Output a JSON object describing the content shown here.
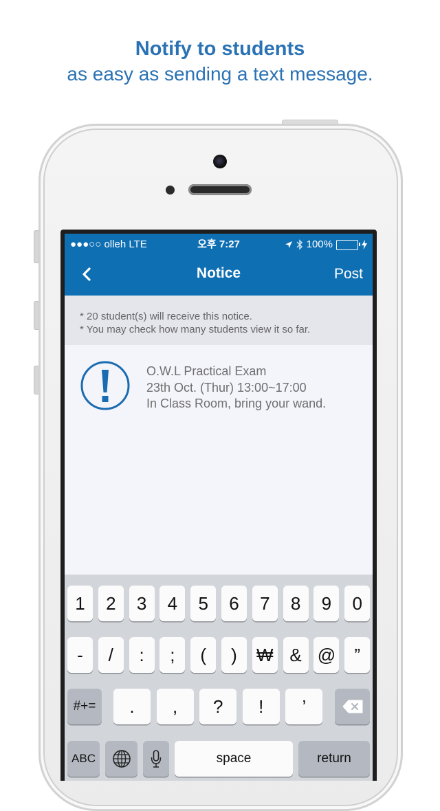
{
  "headline": {
    "title": "Notify to students",
    "subtitle": "as easy as sending a text message."
  },
  "status_bar": {
    "carrier": "●●●○○ olleh  LTE",
    "time": "오후 7:27",
    "battery": "100%",
    "icons": [
      "location-arrow-icon",
      "bluetooth-icon",
      "battery-icon",
      "charging-bolt-icon"
    ]
  },
  "nav": {
    "title": "Notice",
    "post_label": "Post",
    "back_icon": "chevron-left-icon"
  },
  "info": {
    "line1": "* 20 student(s) will receive this notice.",
    "line2": "* You may check how many students view it so far."
  },
  "notice": {
    "icon": "exclamation-circle-icon",
    "line1": "O.W.L Practical Exam",
    "line2": "23th Oct. (Thur) 13:00~17:00",
    "line3": "In Class Room, bring your wand."
  },
  "keyboard": {
    "row1": [
      "1",
      "2",
      "3",
      "4",
      "5",
      "6",
      "7",
      "8",
      "9",
      "0"
    ],
    "row2": [
      "-",
      "/",
      ":",
      ";",
      "(",
      ")",
      "₩",
      "&",
      "@",
      "”"
    ],
    "row3_mode": "#+=",
    "row3": [
      ".",
      ",",
      "?",
      "!",
      "’"
    ],
    "delete_icon": "backspace-icon",
    "abc": "ABC",
    "globe_icon": "globe-icon",
    "mic_icon": "microphone-icon",
    "space": "space",
    "return": "return"
  },
  "colors": {
    "accent": "#0f6fb3",
    "headline": "#2a72b4"
  }
}
